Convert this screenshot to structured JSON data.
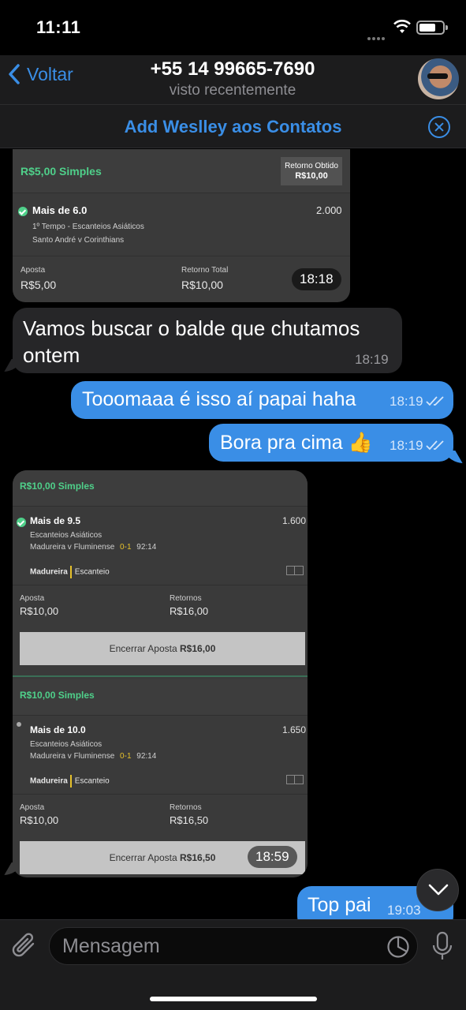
{
  "status": {
    "time": "11:11"
  },
  "header": {
    "back_label": "Voltar",
    "title": "+55 14 99665-7690",
    "subtitle": "visto recentemente"
  },
  "add_contact": {
    "label": "Add Weslley aos Contatos"
  },
  "bet1": {
    "stake_title": "R$5,00 Simples",
    "return_label": "Retorno Obtido",
    "return_value": "R$10,00",
    "selection": "Mais de 6.0",
    "odds": "2.000",
    "market": "1º Tempo - Escanteios Asiáticos",
    "match": "Santo André v Corinthians",
    "stake_label": "Aposta",
    "stake_value": "R$5,00",
    "total_label": "Retorno Total",
    "total_value": "R$10,00",
    "time": "18:18"
  },
  "messages": [
    {
      "text": "Vamos buscar o balde que chutamos ontem",
      "time": "18:19",
      "direction": "in"
    },
    {
      "text": "Tooomaaa é isso aí papai haha",
      "time": "18:19",
      "direction": "out"
    },
    {
      "text": "Bora pra cima 👍",
      "time": "18:19",
      "direction": "out"
    },
    {
      "text": "Top pai",
      "time": "19:03",
      "direction": "out"
    }
  ],
  "bet2": {
    "time": "18:59",
    "sections": [
      {
        "stake_title": "R$10,00 Simples",
        "selection": "Mais de 9.5",
        "odds": "1.600",
        "market": "Escanteios Asiáticos",
        "match": "Madureira v Fluminense",
        "score": "0-1",
        "minute": "92:14",
        "team": "Madureira",
        "event": "Escanteio",
        "stake_label": "Aposta",
        "stake_value": "R$10,00",
        "returns_label": "Retornos",
        "returns_value": "R$16,00",
        "cashout_label": "Encerrar Aposta",
        "cashout_value": "R$16,00"
      },
      {
        "stake_title": "R$10,00 Simples",
        "selection": "Mais de 10.0",
        "odds": "1.650",
        "market": "Escanteios Asiáticos",
        "match": "Madureira v Fluminense",
        "score": "0-1",
        "minute": "92:14",
        "team": "Madureira",
        "event": "Escanteio",
        "stake_label": "Aposta",
        "stake_value": "R$10,00",
        "returns_label": "Retornos",
        "returns_value": "R$16,50",
        "cashout_label": "Encerrar Aposta",
        "cashout_value": "R$16,50"
      }
    ]
  },
  "input": {
    "placeholder": "Mensagem"
  },
  "icons": {
    "back": "chevron-left-icon",
    "close": "close-circle-icon",
    "attach": "paperclip-icon",
    "sticker": "sticker-icon",
    "mic": "microphone-icon",
    "scroll": "chevron-down-icon",
    "read": "double-check-icon"
  },
  "colors": {
    "accent": "#3a8ee6",
    "outgoing": "#3a8ee6",
    "incoming": "#262628",
    "bet_green": "#4fd08a"
  }
}
